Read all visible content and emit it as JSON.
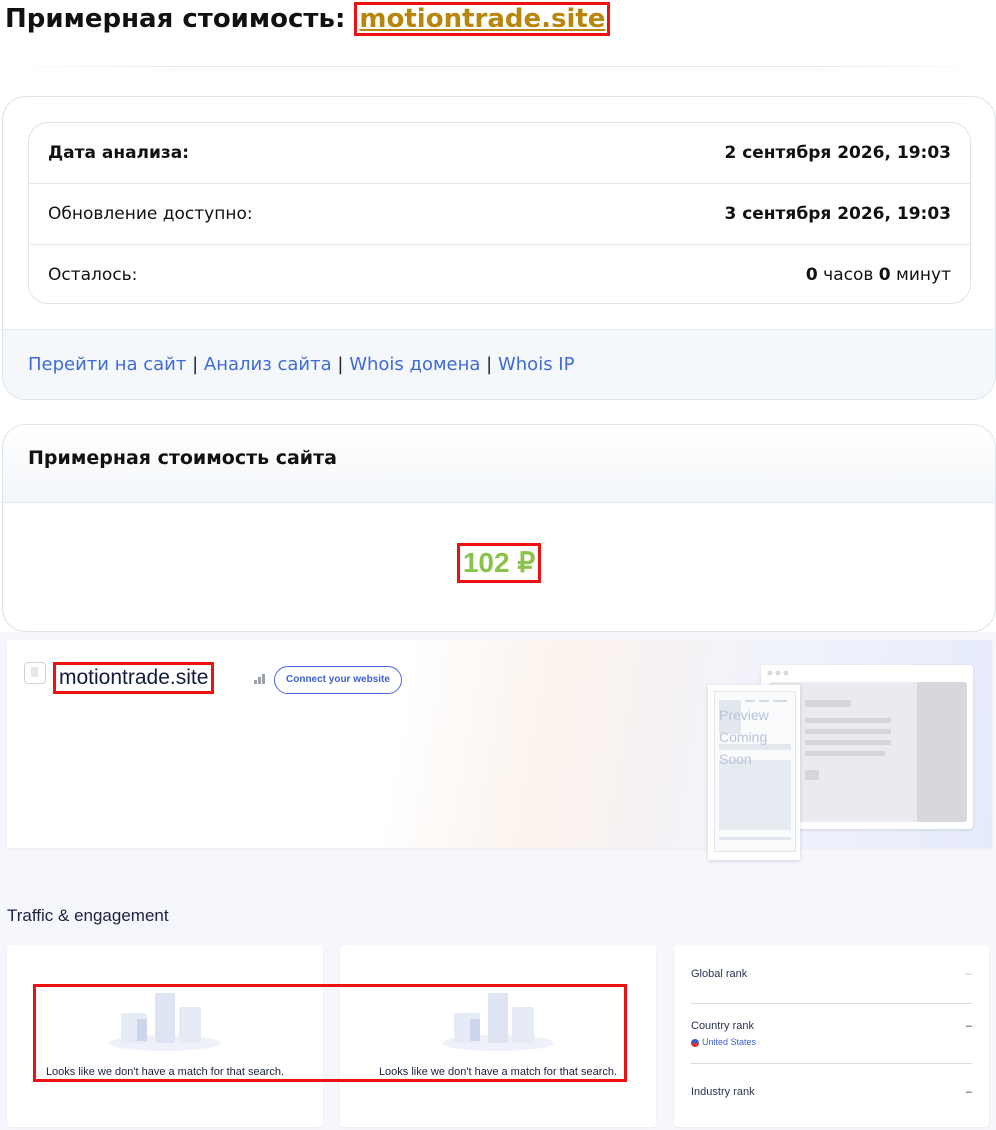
{
  "header": {
    "title_prefix": "Примерная стоимость:",
    "domain": "motiontrade.site"
  },
  "info": {
    "rows": [
      {
        "label": "Дата анализа:",
        "value": "2 сентября 2026, 19:03"
      },
      {
        "label": "Обновление доступно:",
        "value": "3 сентября 2026, 19:03"
      },
      {
        "label": "Осталось:",
        "hours": "0",
        "hours_unit": "часов",
        "minutes": "0",
        "minutes_unit": "минут"
      }
    ]
  },
  "links": [
    "Перейти на сайт",
    "Анализ сайта",
    "Whois домена",
    "Whois IP"
  ],
  "links_separator": "|",
  "valuation": {
    "heading": "Примерная стоимость сайта",
    "price": "102 ₽"
  },
  "widget": {
    "domain": "motiontrade.site",
    "connect_label": "Connect your website",
    "preview_line1": "Preview",
    "preview_line2": "Coming Soon",
    "section_title": "Traffic & engagement",
    "empty_messages": [
      "Looks like we don't have a match for that search.",
      "Looks like we don't have a match for that search."
    ],
    "ranks": [
      {
        "label": "Global rank",
        "value": "–"
      },
      {
        "label": "Country rank",
        "value": "–",
        "country": "United States"
      },
      {
        "label": "Industry rank",
        "value": "–"
      }
    ]
  },
  "colors": {
    "domain": "#b8860b",
    "link": "#3f6ad8",
    "price": "#8bc34a",
    "highlight": "#ee1111",
    "accent": "#3e5fd4"
  }
}
